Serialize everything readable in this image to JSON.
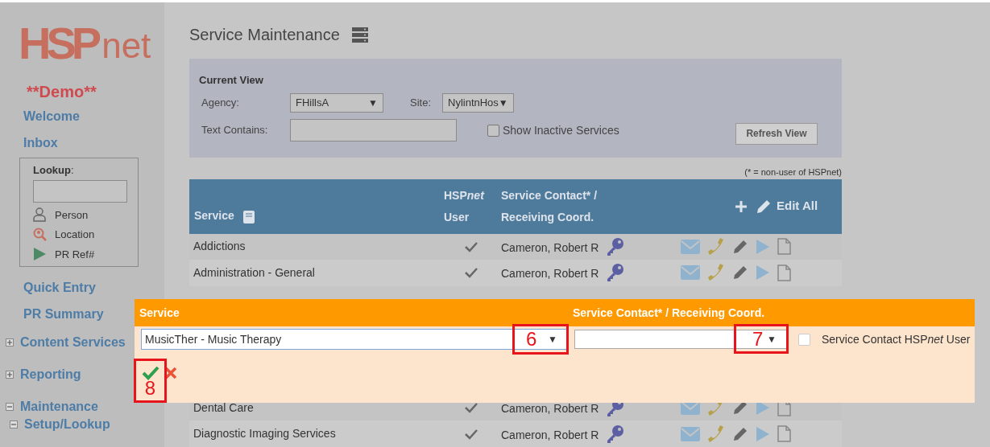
{
  "logo": {
    "prefix": "HSP",
    "suffix": "net"
  },
  "sidebar": {
    "badge": "**Demo**",
    "top_links": [
      "Welcome",
      "Inbox"
    ],
    "lookup": {
      "label": "**Lookup**:",
      "items": [
        {
          "label": "Person",
          "kind": "person"
        },
        {
          "label": "Location",
          "kind": "location"
        },
        {
          "label": "PR Ref#",
          "kind": "referral"
        }
      ]
    },
    "links": [
      "Quick Entry",
      "PR Summary"
    ],
    "sections": [
      {
        "label": "Content Services",
        "expanded": false
      },
      {
        "label": "Reporting",
        "expanded": false
      },
      {
        "label": "Maintenance",
        "expanded": true,
        "children": [
          {
            "label": "Setup/Lookup",
            "expanded": true
          }
        ]
      }
    ]
  },
  "page_title": "Service Maintenance",
  "filter": {
    "heading": "Current View",
    "agency_label": "Agency:",
    "agency": {
      "value": "FHillsA",
      "caret": "▼"
    },
    "site_label": "Site:",
    "site": {
      "value": "NylintnHos",
      "caret": "▼"
    },
    "text_label": "Text Contains:",
    "inactive": {
      "label": "Show Inactive Services",
      "checked": false
    },
    "refresh": "Refresh View"
  },
  "note": "(* = non-user of HSPnet)",
  "table": {
    "columns": [
      {
        "lines": [
          "Service"
        ]
      },
      {
        "prefix": "HSP",
        "italic": "net",
        "line2": "User"
      },
      {
        "lines": [
          "Service Contact* /",
          "Receiving Coord."
        ]
      }
    ],
    "edit_all": "Edit All",
    "rows": [
      {
        "service": "Addictions",
        "user": true,
        "contact": "Cameron, Robert R"
      },
      {
        "service": "Administration - General",
        "user": true,
        "contact": "Cameron, Robert R"
      },
      {
        "service": "Dental Care",
        "user": true,
        "contact": "Cameron, Robert R"
      },
      {
        "service": "Diagnostic Imaging Services",
        "user": true,
        "contact": "Cameron, Robert R"
      }
    ]
  },
  "edit_row": {
    "headers": [
      "Service",
      "Service Contact* / Receiving Coord."
    ],
    "service": {
      "value": "MusicTher - Music Therapy",
      "caret": "▼"
    },
    "contact": {
      "caret": "▼"
    },
    "hspnet_user": {
      "before": "Service Contact HSP",
      "italic": "net",
      "after": " User",
      "checked": false
    }
  },
  "callouts": [
    {
      "label": "6"
    },
    {
      "label": "7"
    },
    {
      "label": "8"
    }
  ]
}
